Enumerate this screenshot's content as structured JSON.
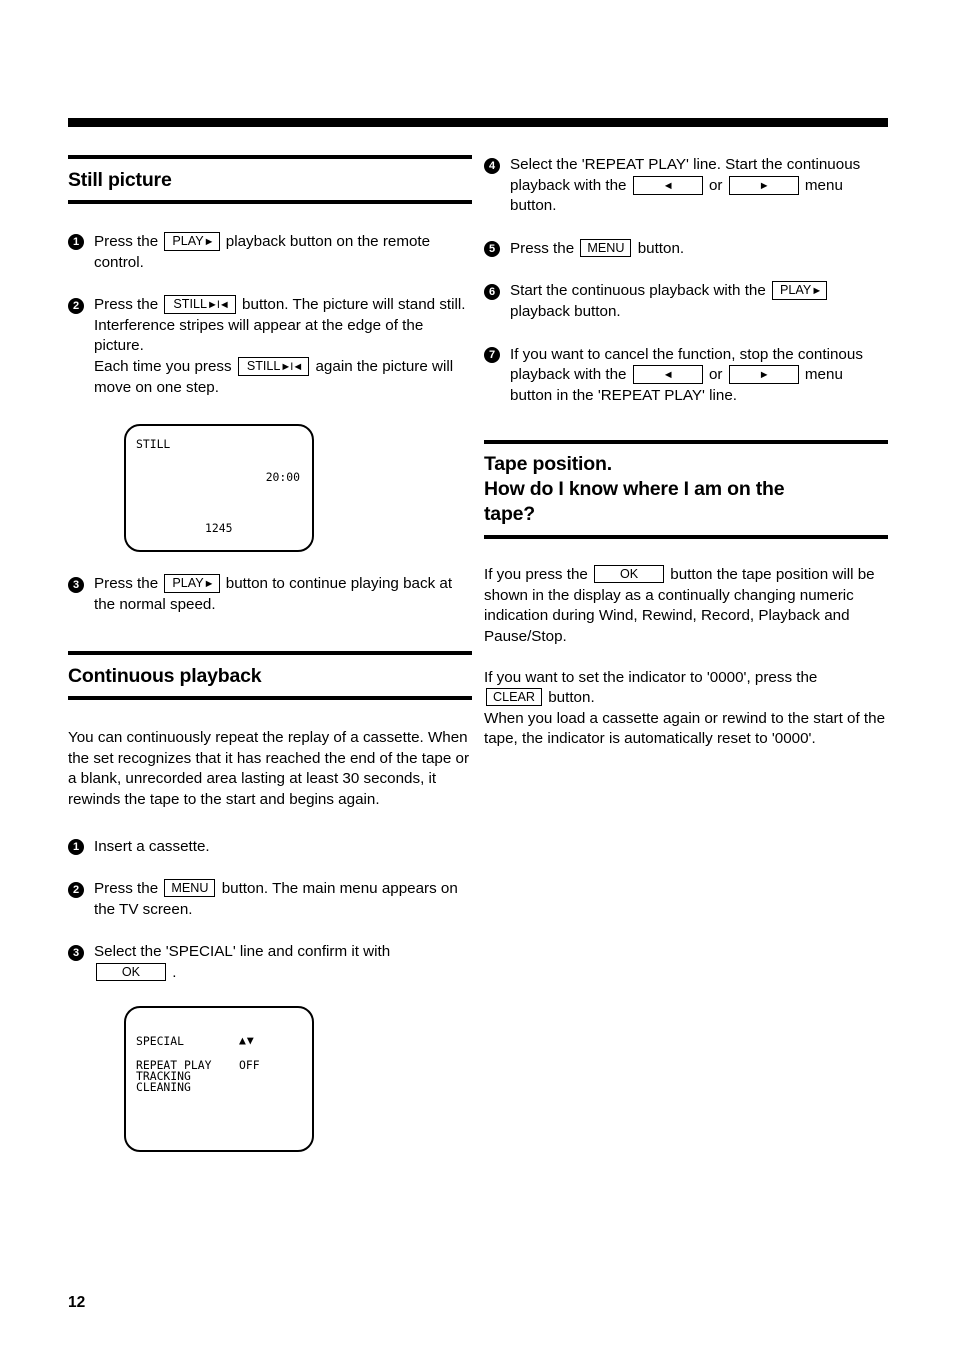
{
  "page": {
    "number": "12"
  },
  "keys": {
    "play": "PLAY",
    "play_glyph": "►",
    "still": "STILL",
    "still_glyph": "►I◄",
    "menu": "MENU",
    "ok": "OK",
    "clear": "CLEAR",
    "left_glyph": "◄",
    "right_glyph": "►"
  },
  "left_column": {
    "still_picture": {
      "title": "Still picture",
      "steps": [
        {
          "num": "1",
          "parts": [
            {
              "t": "text",
              "v": "Press the "
            },
            {
              "t": "key",
              "v": "PLAY ►"
            },
            {
              "t": "text",
              "v": " playback button on the remote control."
            }
          ]
        },
        {
          "num": "2",
          "parts": [
            {
              "t": "text",
              "v": "Press the "
            },
            {
              "t": "key",
              "v": "STILL ►I◄"
            },
            {
              "t": "text",
              "v": " button. The picture will stand still."
            },
            {
              "t": "break",
              "v": ""
            },
            {
              "t": "text",
              "v": "Interference stripes will appear at the edge of the picture."
            },
            {
              "t": "break",
              "v": ""
            },
            {
              "t": "text",
              "v": "Each time you press "
            },
            {
              "t": "key",
              "v": "STILL ►I◄"
            },
            {
              "t": "text",
              "v": " again the picture will move on one step."
            }
          ]
        },
        {
          "num": "3",
          "parts": [
            {
              "t": "text",
              "v": "Press the "
            },
            {
              "t": "key",
              "v": "PLAY ►"
            },
            {
              "t": "text",
              "v": " button to continue playing back at the normal speed."
            }
          ]
        }
      ],
      "screen": {
        "label": "STILL",
        "time": "20:00",
        "counter": "1245"
      }
    },
    "continuous_playback": {
      "title": "Continuous playback",
      "intro": "You can continuously repeat the replay of a cassette. When the set recognizes that it has reached the end of the tape or a blank, unrecorded area lasting at least 30 seconds, it rewinds the tape to the start and begins again.",
      "steps": [
        {
          "num": "1",
          "text": "Insert a cassette."
        },
        {
          "num": "2",
          "text": "Press the MENU button. The main menu appears on the TV screen."
        },
        {
          "num": "3",
          "text": "Select the 'SPECIAL' line and confirm it with OK ."
        }
      ],
      "screen": {
        "title": "SPECIAL",
        "arrows": "▲▼",
        "rows": [
          {
            "name": "REPEAT PLAY",
            "value": "OFF"
          },
          {
            "name": "TRACKING",
            "value": ""
          },
          {
            "name": "CLEANING",
            "value": ""
          }
        ]
      }
    }
  },
  "right_column": {
    "continuous_playback_steps": [
      {
        "num": "4",
        "text": "Select the 'REPEAT PLAY' line. Start the continuous playback with the ◄ or ► menu button."
      },
      {
        "num": "5",
        "text": "Press the MENU button."
      },
      {
        "num": "6",
        "text": "Start the continuous playback with the PLAY ► playback button."
      },
      {
        "num": "7",
        "text": "If you want to cancel the function, stop the continous playback with the ◄ or ► menu button in the 'REPEAT PLAY' line."
      }
    ],
    "tape_position": {
      "title_line1": "Tape position.",
      "title_line2": "How do I know where I am on the",
      "title_line3": "tape?",
      "para1_a": "If you press the ",
      "para1_b": " button the tape position will be shown in the display as a continually changing numeric indication during Wind, Rewind, Record, Playback and Pause/Stop.",
      "para2_a": "If you want to set the indicator to '0000', press the ",
      "para2_b": " button.",
      "para2_c": "When you load a cassette again or rewind to the start of the tape, the indicator is automatically reset to '0000'."
    }
  }
}
